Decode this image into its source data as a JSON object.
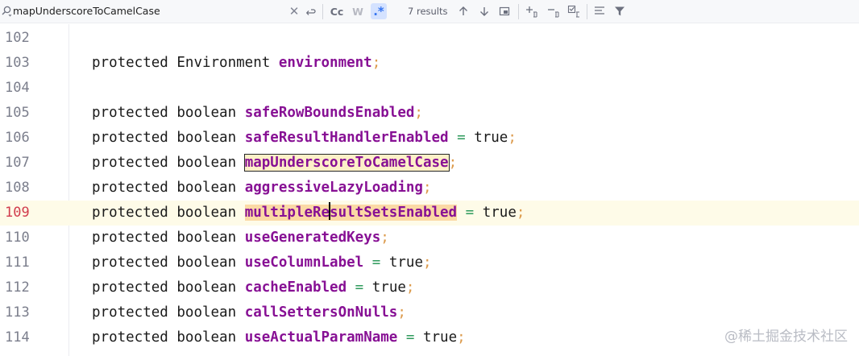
{
  "findbar": {
    "query": "mapUnderscoreToCamelCase",
    "match_case_label": "Cc",
    "words_label": "W",
    "regex_label": ".*",
    "results": "7 results",
    "icons": {
      "search": "search-icon",
      "clear": "close-icon",
      "newline": "newline-icon",
      "up": "arrow-up-icon",
      "down": "arrow-down-icon",
      "select": "select-occurrence-icon",
      "add": "add-selection-icon",
      "remove": "remove-selection-icon",
      "select_all": "select-all-icon",
      "filter_lines": "filter-lines-icon",
      "filter": "funnel-icon"
    }
  },
  "editor": {
    "current_line": "109",
    "lines": [
      {
        "number": "102",
        "code": ""
      },
      {
        "number": "103",
        "keyword": "protected",
        "type": "Environment",
        "field": "environment",
        "assign": "",
        "value": "",
        "end": ";"
      },
      {
        "number": "104",
        "code": ""
      },
      {
        "number": "105",
        "keyword": "protected",
        "type": "boolean",
        "field": "safeRowBoundsEnabled",
        "assign": "",
        "value": "",
        "end": ";"
      },
      {
        "number": "106",
        "keyword": "protected",
        "type": "boolean",
        "field": "safeResultHandlerEnabled",
        "assign": "=",
        "value": "true",
        "end": ";"
      },
      {
        "number": "107",
        "keyword": "protected",
        "type": "boolean",
        "field": "mapUnderscoreToCamelCase",
        "assign": "",
        "value": "",
        "end": ";"
      },
      {
        "number": "108",
        "keyword": "protected",
        "type": "boolean",
        "field": "aggressiveLazyLoading",
        "assign": "",
        "value": "",
        "end": ";"
      },
      {
        "number": "109",
        "keyword": "protected",
        "type": "boolean",
        "field_a": "multipleRe",
        "field_b": "sultSetsEnabled",
        "assign": "=",
        "value": "true",
        "end": ";"
      },
      {
        "number": "110",
        "keyword": "protected",
        "type": "boolean",
        "field": "useGeneratedKeys",
        "assign": "",
        "value": "",
        "end": ";"
      },
      {
        "number": "111",
        "keyword": "protected",
        "type": "boolean",
        "field": "useColumnLabel",
        "assign": "=",
        "value": "true",
        "end": ";"
      },
      {
        "number": "112",
        "keyword": "protected",
        "type": "boolean",
        "field": "cacheEnabled",
        "assign": "=",
        "value": "true",
        "end": ";"
      },
      {
        "number": "113",
        "keyword": "protected",
        "type": "boolean",
        "field": "callSettersOnNulls",
        "assign": "",
        "value": "",
        "end": ";"
      },
      {
        "number": "114",
        "keyword": "protected",
        "type": "boolean",
        "field": "useActualParamName",
        "assign": "=",
        "value": "true",
        "end": ";"
      }
    ]
  },
  "watermark": "@稀土掘金技术社区"
}
